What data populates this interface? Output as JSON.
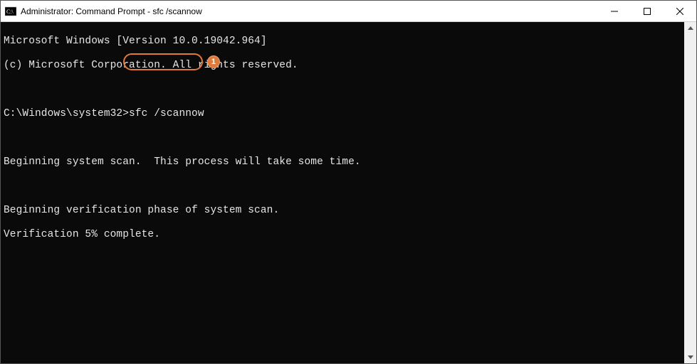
{
  "titlebar": {
    "title": "Administrator: Command Prompt - sfc  /scannow",
    "icon_name": "cmd-icon"
  },
  "window_controls": {
    "minimize": "minimize",
    "maximize": "maximize",
    "close": "close"
  },
  "terminal": {
    "lines": [
      "Microsoft Windows [Version 10.0.19042.964]",
      "(c) Microsoft Corporation. All rights reserved.",
      "",
      "C:\\Windows\\system32>sfc /scannow",
      "",
      "Beginning system scan.  This process will take some time.",
      "",
      "Beginning verification phase of system scan.",
      "Verification 5% complete."
    ],
    "prompt_prefix": "C:\\Windows\\system32>",
    "command": "sfc /scannow"
  },
  "annotations": {
    "highlight_command": "sfc /scannow",
    "callout_number": "1"
  },
  "colors": {
    "accent": "#e07a3a",
    "terminal_bg": "#0a0a0a",
    "terminal_fg": "#e6e6e6"
  }
}
